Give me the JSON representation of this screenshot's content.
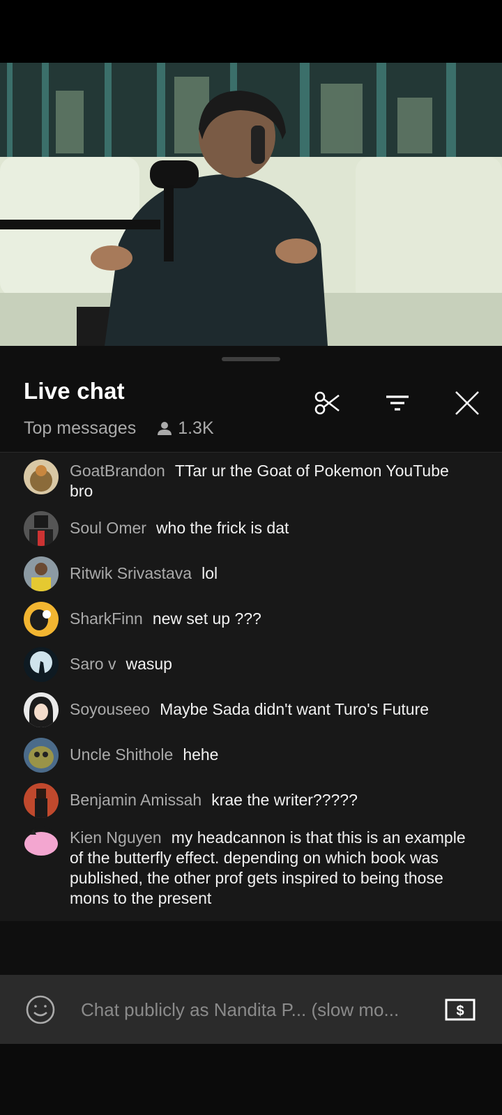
{
  "chat": {
    "title": "Live chat",
    "mode": "Top messages",
    "viewer_count": "1.3K"
  },
  "messages": [
    {
      "author": "GoatBrandon",
      "text": "TTar ur the Goat of Pokemon YouTube bro",
      "avatar_color": "#8b6b3a"
    },
    {
      "author": "Soul Omer",
      "text": "who the frick is dat",
      "avatar_color": "#3a3a3a"
    },
    {
      "author": "Ritwik Srivastava",
      "text": "lol",
      "avatar_color": "#c9b24a"
    },
    {
      "author": "SharkFinn",
      "text": "new set up ???",
      "avatar_color": "#f2b531"
    },
    {
      "author": "Saro v",
      "text": "wasup",
      "avatar_color": "#6a7f8f"
    },
    {
      "author": "Soyouseeo",
      "text": "Maybe Sada didn't want Turo's Future",
      "avatar_color": "#e6e6e6"
    },
    {
      "author": "Uncle Shithole",
      "text": "hehe",
      "avatar_color": "#7d7a3c"
    },
    {
      "author": "Benjamin Amissah",
      "text": "krae the writer?????",
      "avatar_color": "#c0492d"
    },
    {
      "author": "Kien Nguyen",
      "text": "my headcannon is that this is an example of the butterfly effect. depending on which book was published, the other prof gets inspired to being those mons to the present",
      "avatar_color": "#f3a6d0"
    }
  ],
  "input": {
    "placeholder": "Chat publicly as Nandita P... (slow mo..."
  },
  "icons": {
    "scissors": "scissors-icon",
    "filter": "filter-icon",
    "close": "close-icon",
    "person": "person-icon",
    "emoji": "emoji-icon",
    "superchat": "dollar-icon"
  },
  "colors": {
    "panel_bg": "#0f0f0f",
    "messages_bg": "#181818",
    "author_text": "#aaaaaa",
    "input_bg": "#2b2b2b"
  }
}
